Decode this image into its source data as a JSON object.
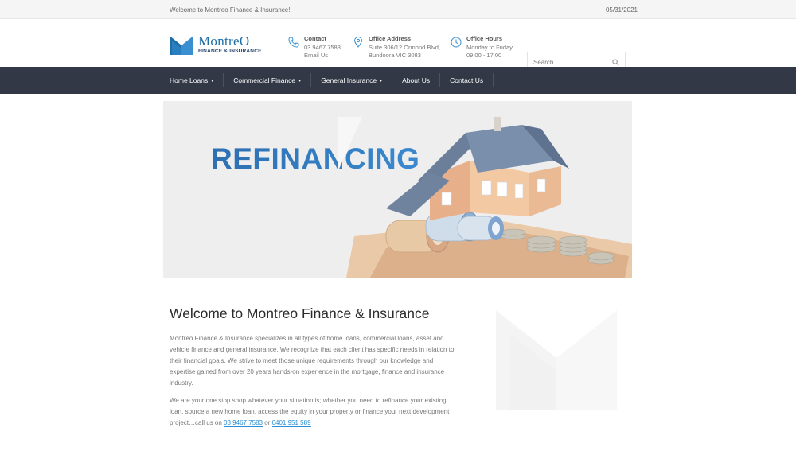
{
  "topbar": {
    "welcome": "Welcome to Montreo Finance & Insurance!",
    "date": "05/31/2021"
  },
  "logo": {
    "name": "MontreO",
    "sub": "FINANCE & INSURANCE"
  },
  "contact": {
    "title": "Contact",
    "phone": "03 9467 7583",
    "email": "Email Us"
  },
  "office": {
    "title": "Office Address",
    "line1": "Suite 306/12 Ormond Blvd,",
    "line2": "Bundoora VIC 3083"
  },
  "hours": {
    "title": "Office Hours",
    "line1": "Monday to Friday,",
    "line2": "09:00 - 17:00"
  },
  "search": {
    "placeholder": "Search ..."
  },
  "nav": {
    "items": [
      {
        "label": "Home Loans",
        "caret": "▾"
      },
      {
        "label": "Commercial Finance",
        "caret": "▾"
      },
      {
        "label": "General Insurance",
        "caret": "▾"
      },
      {
        "label": "About Us",
        "caret": ""
      },
      {
        "label": "Contact Us",
        "caret": ""
      }
    ]
  },
  "hero": {
    "title": "REFINANCING"
  },
  "main": {
    "heading": "Welcome to Montreo Finance & Insurance",
    "para1": "Montreo Finance & Insurance specializes in all types of home loans, commercial loans, asset and vehicle finance and general insurance. We recognize that each client has specific needs in relation to their financial goals. We strive to meet those unique requirements through our knowledge and expertise gained from over 20 years hands-on experience in the mortgage, finance and insurance industry.",
    "para2_text": "We are your one stop shop whatever your situation is; whether you need to refinance your existing loan, source a new home loan, access the equity in your property or finance your next development project…call us on",
    "phone1": "03 9467 7583",
    "or": "or",
    "phone2": "0401 951 589"
  },
  "colors": {
    "nav_bg": "#323845",
    "accent": "#2a8fd4",
    "logo_blue": "#1e6fa8"
  }
}
